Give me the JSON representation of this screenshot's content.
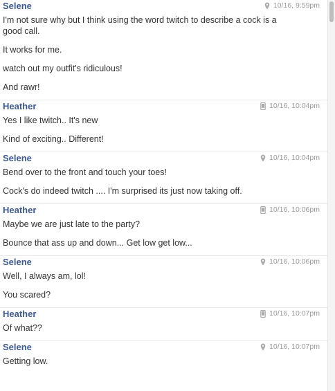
{
  "groups": [
    {
      "sender": "Selene",
      "time": "10/16, 9:59pm",
      "device": "location-pin-icon",
      "messages": [
        "I'm not sure why but I think using the word twitch to describe  a cock is a good call.",
        "It works for me.",
        "watch out my outfit's ridiculous!",
        "And rawr!"
      ]
    },
    {
      "sender": "Heather",
      "time": "10/16, 10:04pm",
      "device": "mobile-phone-icon",
      "messages": [
        "Yes I like twitch.. It's new",
        "Kind of exciting.. Different!"
      ]
    },
    {
      "sender": "Selene",
      "time": "10/16, 10:04pm",
      "device": "location-pin-icon",
      "messages": [
        "Bend over to the front and touch your toes!",
        "Cock's do indeed twitch .... I'm surprised its just now taking off."
      ]
    },
    {
      "sender": "Heather",
      "time": "10/16, 10:06pm",
      "device": "mobile-phone-icon",
      "messages": [
        "Maybe we are just late to the party?",
        "Bounce that ass up and down... Get low get low..."
      ]
    },
    {
      "sender": "Selene",
      "time": "10/16, 10:06pm",
      "device": "location-pin-icon",
      "messages": [
        "Well, I always am, lol!",
        "You scared?"
      ]
    },
    {
      "sender": "Heather",
      "time": "10/16, 10:07pm",
      "device": "mobile-phone-icon",
      "messages": [
        "Of what??"
      ]
    },
    {
      "sender": "Selene",
      "time": "10/16, 10:07pm",
      "device": "location-pin-icon",
      "messages": [
        "Getting low."
      ]
    }
  ],
  "colors": {
    "sender": "#3b5998",
    "meta": "#999999",
    "text": "#333333"
  }
}
